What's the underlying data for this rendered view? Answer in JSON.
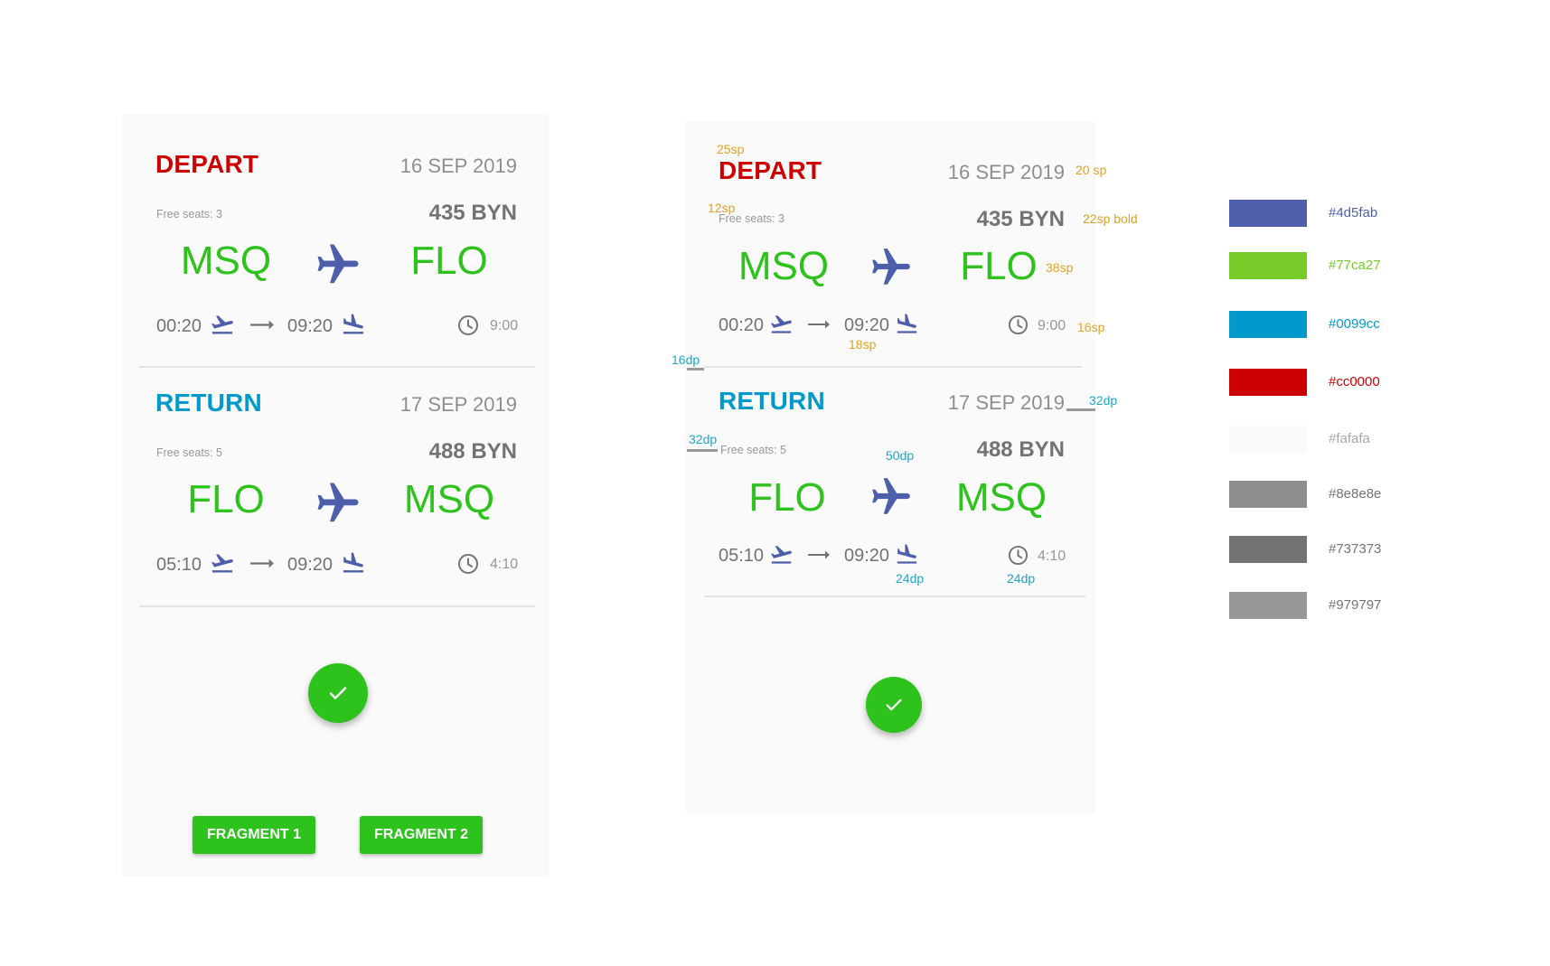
{
  "flights": [
    {
      "title": "DEPART",
      "title_color": "#cc0000",
      "date": "16 SEP 2019",
      "seats": "Free seats: 3",
      "price": "435 BYN",
      "from": "MSQ",
      "to": "FLO",
      "dep_time": "00:20",
      "arr_time": "09:20",
      "duration": "9:00"
    },
    {
      "title": "RETURN",
      "title_color": "#0099cc",
      "date": "17 SEP 2019",
      "seats": "Free seats: 5",
      "price": "488 BYN",
      "from": "FLO",
      "to": "MSQ",
      "dep_time": "05:10",
      "arr_time": "09:20",
      "duration": "4:10"
    }
  ],
  "buttons": {
    "fragment1": "FRAGMENT 1",
    "fragment2": "FRAGMENT 2"
  },
  "annotations": {
    "title_size": "25sp",
    "date_size": "20 sp",
    "seats_size": "12sp",
    "price_size": "22sp bold",
    "code_size": "38sp",
    "duration_size": "16sp",
    "time_size": "18sp",
    "margin_16": "16dp",
    "margin_32_left": "32dp",
    "margin_32_right": "32dp",
    "plane_size": "50dp",
    "icon_size": "24dp",
    "clock_size": "24dp"
  },
  "palette": [
    {
      "hex": "#4d5fab",
      "label": "#4d5fab",
      "label_color": "#4d5fab"
    },
    {
      "hex": "#77ca27",
      "label": "#77ca27",
      "label_color": "#77ca27"
    },
    {
      "hex": "#0099cc",
      "label": "#0099cc",
      "label_color": "#0099cc"
    },
    {
      "hex": "#cc0000",
      "label": "#cc0000",
      "label_color": "#cc0000"
    },
    {
      "hex": "#fafafa",
      "label": "#fafafa",
      "label_color": "#a8a8a8"
    },
    {
      "hex": "#8e8e8e",
      "label": "#8e8e8e",
      "label_color": "#737373"
    },
    {
      "hex": "#737373",
      "label": "#737373",
      "label_color": "#737373"
    },
    {
      "hex": "#979797",
      "label": "#979797",
      "label_color": "#737373"
    }
  ],
  "colors": {
    "primary": "#4d5fab",
    "green": "#2ec21c",
    "background": "#fafafa"
  },
  "icons": [
    "airplane-icon",
    "takeoff-icon",
    "landing-icon",
    "arrow-right-icon",
    "clock-icon",
    "check-icon"
  ]
}
